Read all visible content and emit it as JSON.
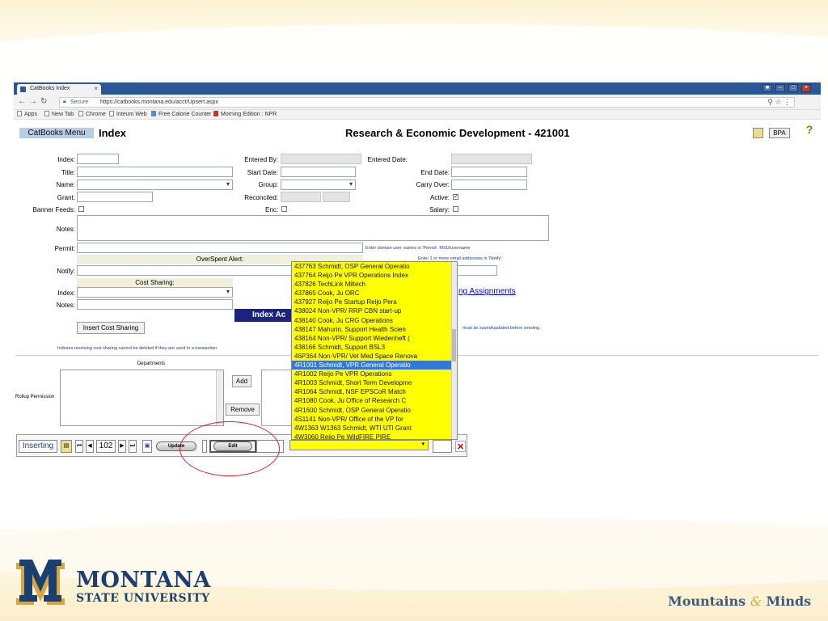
{
  "browser": {
    "tab_title": "CatBooks Index",
    "tab_close": "×",
    "secure_label": "Secure",
    "url": "https://catbooks.montana.edu/acct/Upsert.aspx",
    "bookmarks": [
      "Apps",
      "New Tab",
      "Chrome",
      "Inteum Web",
      "Free Calorie Counter",
      "Morning Edition : NPR"
    ]
  },
  "header": {
    "menu_button": "CatBooks Menu",
    "page_title": "Index",
    "center_title": "Research & Economic Development - 421001",
    "bpa_button": "BPA",
    "help_icon": "?"
  },
  "form": {
    "index_label": "Index:",
    "title_label": "Title:",
    "name_label": "Name:",
    "grant_label": "Grant:",
    "banner_feeds_label": "Banner Feeds:",
    "notes_label": "Notes:",
    "permit_label": "Permit:",
    "notify_label": "Notify:",
    "entered_by_label": "Entered By:",
    "entered_date_label": "Entered Date:",
    "start_date_label": "Start Date:",
    "end_date_label": "End Date:",
    "group_label": "Group:",
    "carry_over_label": "Carry Over:",
    "reconciled_label": "Reconciled:",
    "active_label": "Active:",
    "active_check": "✓",
    "enc_label": "Enc:",
    "salary_label": "Salary:",
    "permit_hint": "Enter domain user names in 'Permit'. MSU\\username",
    "notify_hint": "Enter 1 or more email addresses in 'Notify'.",
    "overspent_alert": "OverSpent Alert:",
    "cost_sharing": "Cost Sharing:",
    "cs_index_label": "Index:",
    "cs_notes_label": "Notes:",
    "index_header": "Index Ac",
    "assignments_link": "ng Assignments",
    "save_hint": "must be saved/updated before seeding.",
    "insert_cost_sharing": "Insert Cost Sharing",
    "cost_sharing_warning": "Indexes receiving cost sharing cannot be deleted if they are used in a transaction.",
    "departments_label": "Departments",
    "rollup_label": "Rollup Permission",
    "add_button": "Add",
    "remove_button": "Remove"
  },
  "toolbar": {
    "status": "Inserting",
    "record": "102",
    "update": "Update",
    "edit": "Edit",
    "delete_icon": "✕"
  },
  "dropdown": {
    "selected_index": 11,
    "items": [
      "437763 Schmidt, OSP General Operatio",
      "437764 Reijo Pe VPR Operations Index",
      "437826 TechLink Miltech",
      "437865 Cook, Ju ORC",
      "437927 Reijo Pe Startup Reijo Pera",
      "438024 Non-VPR/ RRP CBN start-up",
      "438140 Cook, Ju CRG Operations",
      "438147 Mahurin, Support Health Scien",
      "438164 Non-VPR/ Support Wiedenheft (",
      "438166 Schmidt, Support BSL3",
      "46P364 Non-VPR/ Vet Med Space Renova",
      "4R1001 Schmidt, VPR General Operatio",
      "4R1002 Reijo Pe VPR Operations",
      "4R1003 Schmidt, Short Term Developme",
      "4R1064 Schmidt, NSF EPSCoR Match",
      "4R1080 Cook, Ju Office of Research C",
      "4R1600 Schmidt, OSP General Operatio",
      "4S1141 Non-VPR/ Office of the VP for",
      "4W1363 W1363 Schmidt, WTI UTI Grant",
      "4W3060 Reijo Pe WildFIRE PIRE"
    ]
  },
  "branding": {
    "university": "MONTANA",
    "university_sub": "STATE UNIVERSITY",
    "tagline_a": "Mountains",
    "tagline_amp": "&",
    "tagline_b": "Minds",
    "brand_blue": "#1c3f72",
    "brand_gold": "#d6a640"
  },
  "colors": {
    "dropdown_bg": "#ffff00",
    "selection": "#3378d6",
    "annotation": "#e02020"
  }
}
